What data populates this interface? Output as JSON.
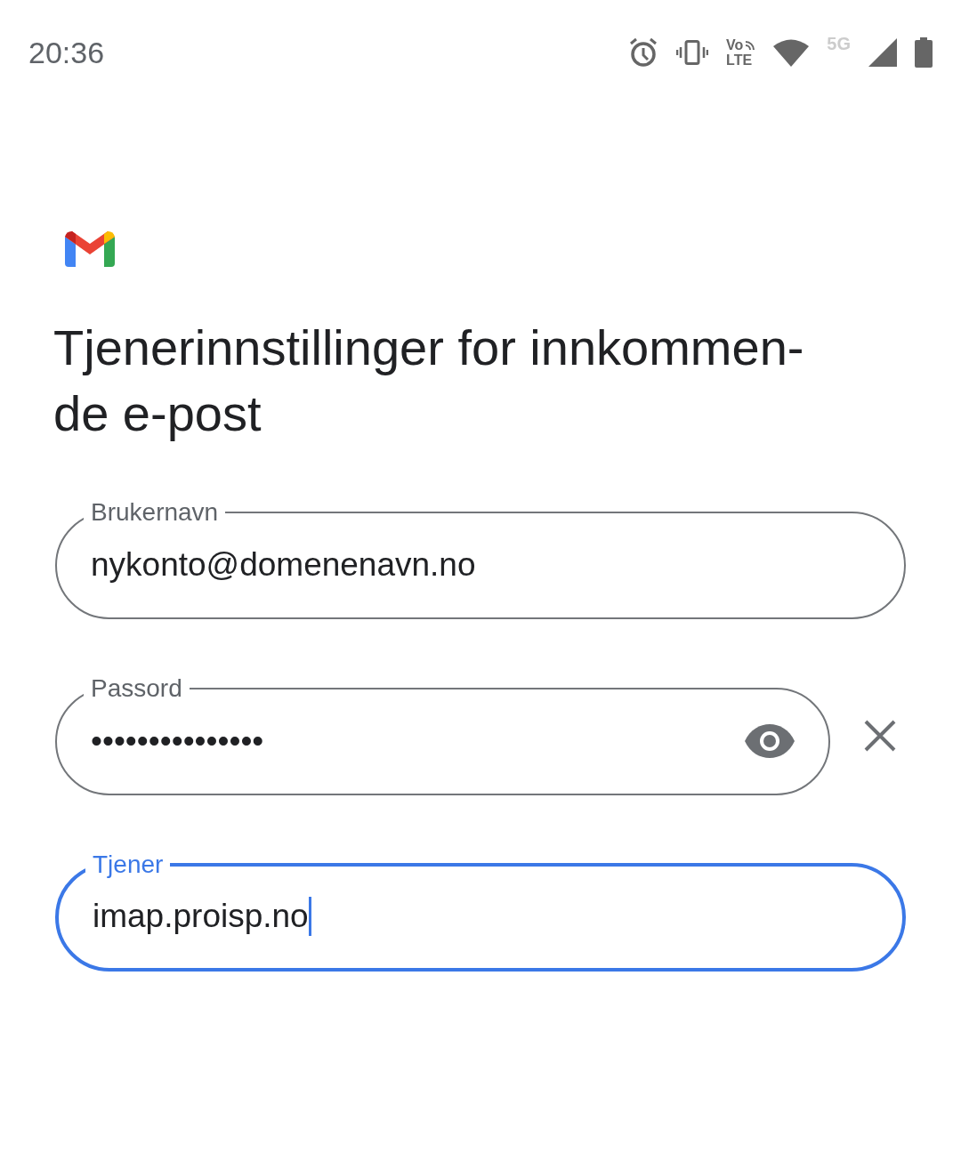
{
  "status_bar": {
    "time": "20:36",
    "volte_top": "Vo",
    "volte_bottom": "LTE",
    "network": "5G"
  },
  "title_lines": [
    "Tjenerinnstillinger for innkommen-",
    "de e-post"
  ],
  "fields": [
    {
      "kind": "text",
      "label": "Brukernavn",
      "value": "nykonto@domenenavn.no",
      "focused": false
    },
    {
      "kind": "password",
      "label": "Passord",
      "value": "•••••••••••••••",
      "focused": false
    },
    {
      "kind": "text",
      "label": "Tjener",
      "value": "imap.proisp.no",
      "focused": true
    }
  ]
}
